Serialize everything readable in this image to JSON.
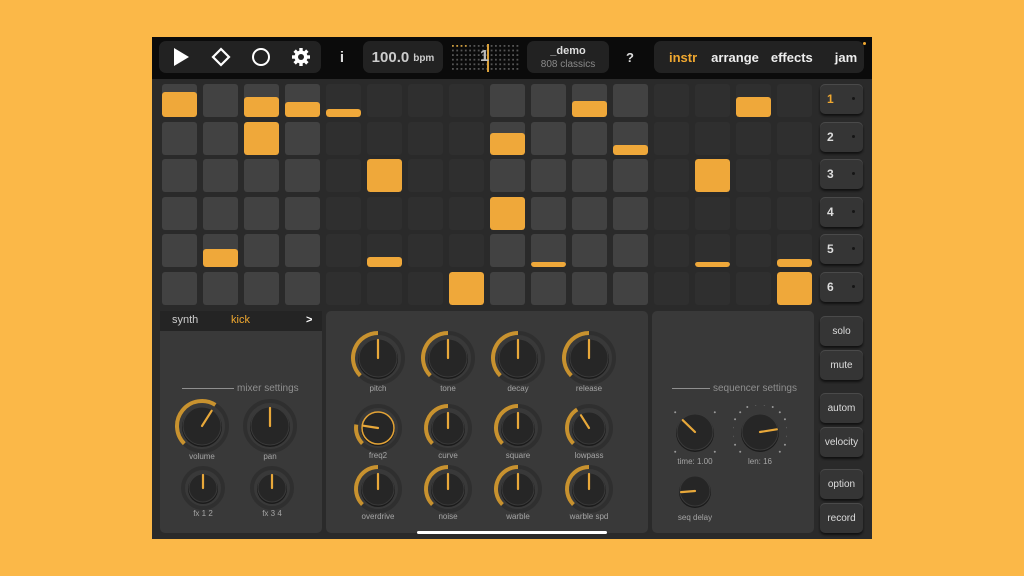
{
  "toolbar": {
    "transport": [
      {
        "name": "play",
        "icon": "play-icon"
      },
      {
        "name": "pattern",
        "icon": "diamond-icon"
      },
      {
        "name": "record",
        "icon": "circle-icon"
      },
      {
        "name": "settings",
        "icon": "gear-icon"
      }
    ],
    "info_label": "i",
    "bpm_value": "100.0",
    "bpm_unit": "bpm",
    "pattern_number": "1",
    "song_name": "_demo",
    "kit_name": "808 classics",
    "help_label": "?",
    "modes": [
      {
        "label": "instr",
        "active": true
      },
      {
        "label": "arrange",
        "active": false
      },
      {
        "label": "effects",
        "active": false
      },
      {
        "label": "jam",
        "active": false
      }
    ]
  },
  "colors": {
    "accent": "#efa83a",
    "background": "#fbb848",
    "cell_light": "#424242",
    "cell_dark": "#2f2f2f"
  },
  "sequencer": {
    "rows": 6,
    "steps": 16,
    "active_steps": [
      {
        "row": 0,
        "step": 0,
        "velocity": 0.75
      },
      {
        "row": 0,
        "step": 2,
        "velocity": 0.6
      },
      {
        "row": 0,
        "step": 3,
        "velocity": 0.45
      },
      {
        "row": 0,
        "step": 4,
        "velocity": 0.25
      },
      {
        "row": 0,
        "step": 10,
        "velocity": 0.5
      },
      {
        "row": 0,
        "step": 14,
        "velocity": 0.6
      },
      {
        "row": 1,
        "step": 2,
        "velocity": 1.0
      },
      {
        "row": 1,
        "step": 8,
        "velocity": 0.65
      },
      {
        "row": 1,
        "step": 11,
        "velocity": 0.3
      },
      {
        "row": 2,
        "step": 5,
        "velocity": 1.0
      },
      {
        "row": 2,
        "step": 13,
        "velocity": 1.0
      },
      {
        "row": 3,
        "step": 8,
        "velocity": 1.0
      },
      {
        "row": 4,
        "step": 1,
        "velocity": 0.55
      },
      {
        "row": 4,
        "step": 5,
        "velocity": 0.3
      },
      {
        "row": 4,
        "step": 9,
        "velocity": 0.15
      },
      {
        "row": 4,
        "step": 13,
        "velocity": 0.12
      },
      {
        "row": 4,
        "step": 15,
        "velocity": 0.25
      },
      {
        "row": 5,
        "step": 7,
        "velocity": 1.0
      },
      {
        "row": 5,
        "step": 15,
        "velocity": 1.0
      }
    ]
  },
  "tracks": [
    {
      "label": "1",
      "active": true
    },
    {
      "label": "2",
      "active": false
    },
    {
      "label": "3",
      "active": false
    },
    {
      "label": "4",
      "active": false
    },
    {
      "label": "5",
      "active": false
    },
    {
      "label": "6",
      "active": false
    }
  ],
  "side_buttons": [
    "solo",
    "mute",
    "autom",
    "velocity",
    "option",
    "record"
  ],
  "instrument": {
    "type_label": "synth",
    "name": "kick",
    "next_label": ">"
  },
  "mixer": {
    "title": "mixer settings",
    "knobs": [
      {
        "label": "volume",
        "value": 0.62
      },
      {
        "label": "pan",
        "value": 0.5
      },
      {
        "label": "fx 1 2",
        "value": 0.5
      },
      {
        "label": "fx 3 4",
        "value": 0.5
      }
    ]
  },
  "synth_knobs": [
    {
      "label": "pitch",
      "value": 0.5
    },
    {
      "label": "tone",
      "value": 0.5
    },
    {
      "label": "decay",
      "value": 0.5
    },
    {
      "label": "release",
      "value": 0.5
    },
    {
      "label": "freq2",
      "value": 0.2
    },
    {
      "label": "curve",
      "value": 0.5
    },
    {
      "label": "square",
      "value": 0.5
    },
    {
      "label": "lowpass",
      "value": 0.38
    },
    {
      "label": "overdrive",
      "value": 0.5
    },
    {
      "label": "noise",
      "value": 0.5
    },
    {
      "label": "warble",
      "value": 0.5
    },
    {
      "label": "warble spd",
      "value": 0.5
    }
  ],
  "seq_settings": {
    "title": "sequencer settings",
    "knobs": [
      {
        "label": "time: 1.00",
        "value": 0.33
      },
      {
        "label": "len: 16",
        "value": 0.8
      },
      {
        "label": "seq delay",
        "value": 0.15
      }
    ]
  }
}
